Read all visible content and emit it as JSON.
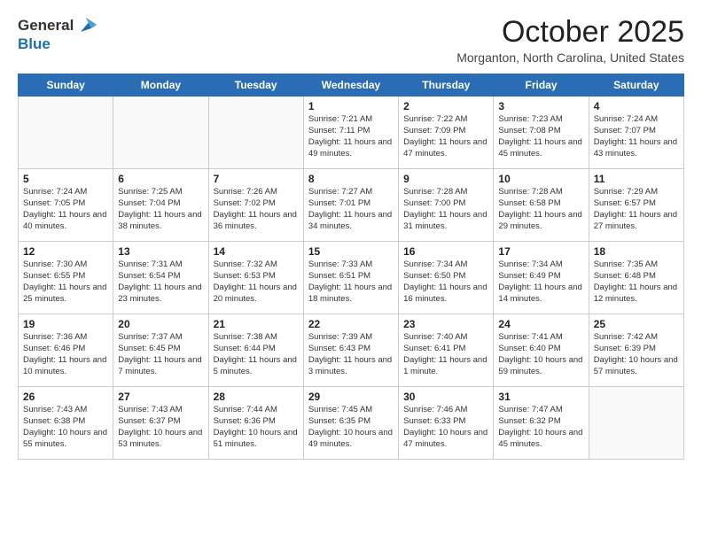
{
  "header": {
    "logo_general": "General",
    "logo_blue": "Blue",
    "month_title": "October 2025",
    "location": "Morganton, North Carolina, United States"
  },
  "days_of_week": [
    "Sunday",
    "Monday",
    "Tuesday",
    "Wednesday",
    "Thursday",
    "Friday",
    "Saturday"
  ],
  "weeks": [
    [
      {
        "day": "",
        "info": ""
      },
      {
        "day": "",
        "info": ""
      },
      {
        "day": "",
        "info": ""
      },
      {
        "day": "1",
        "info": "Sunrise: 7:21 AM\nSunset: 7:11 PM\nDaylight: 11 hours\nand 49 minutes."
      },
      {
        "day": "2",
        "info": "Sunrise: 7:22 AM\nSunset: 7:09 PM\nDaylight: 11 hours\nand 47 minutes."
      },
      {
        "day": "3",
        "info": "Sunrise: 7:23 AM\nSunset: 7:08 PM\nDaylight: 11 hours\nand 45 minutes."
      },
      {
        "day": "4",
        "info": "Sunrise: 7:24 AM\nSunset: 7:07 PM\nDaylight: 11 hours\nand 43 minutes."
      }
    ],
    [
      {
        "day": "5",
        "info": "Sunrise: 7:24 AM\nSunset: 7:05 PM\nDaylight: 11 hours\nand 40 minutes."
      },
      {
        "day": "6",
        "info": "Sunrise: 7:25 AM\nSunset: 7:04 PM\nDaylight: 11 hours\nand 38 minutes."
      },
      {
        "day": "7",
        "info": "Sunrise: 7:26 AM\nSunset: 7:02 PM\nDaylight: 11 hours\nand 36 minutes."
      },
      {
        "day": "8",
        "info": "Sunrise: 7:27 AM\nSunset: 7:01 PM\nDaylight: 11 hours\nand 34 minutes."
      },
      {
        "day": "9",
        "info": "Sunrise: 7:28 AM\nSunset: 7:00 PM\nDaylight: 11 hours\nand 31 minutes."
      },
      {
        "day": "10",
        "info": "Sunrise: 7:28 AM\nSunset: 6:58 PM\nDaylight: 11 hours\nand 29 minutes."
      },
      {
        "day": "11",
        "info": "Sunrise: 7:29 AM\nSunset: 6:57 PM\nDaylight: 11 hours\nand 27 minutes."
      }
    ],
    [
      {
        "day": "12",
        "info": "Sunrise: 7:30 AM\nSunset: 6:55 PM\nDaylight: 11 hours\nand 25 minutes."
      },
      {
        "day": "13",
        "info": "Sunrise: 7:31 AM\nSunset: 6:54 PM\nDaylight: 11 hours\nand 23 minutes."
      },
      {
        "day": "14",
        "info": "Sunrise: 7:32 AM\nSunset: 6:53 PM\nDaylight: 11 hours\nand 20 minutes."
      },
      {
        "day": "15",
        "info": "Sunrise: 7:33 AM\nSunset: 6:51 PM\nDaylight: 11 hours\nand 18 minutes."
      },
      {
        "day": "16",
        "info": "Sunrise: 7:34 AM\nSunset: 6:50 PM\nDaylight: 11 hours\nand 16 minutes."
      },
      {
        "day": "17",
        "info": "Sunrise: 7:34 AM\nSunset: 6:49 PM\nDaylight: 11 hours\nand 14 minutes."
      },
      {
        "day": "18",
        "info": "Sunrise: 7:35 AM\nSunset: 6:48 PM\nDaylight: 11 hours\nand 12 minutes."
      }
    ],
    [
      {
        "day": "19",
        "info": "Sunrise: 7:36 AM\nSunset: 6:46 PM\nDaylight: 11 hours\nand 10 minutes."
      },
      {
        "day": "20",
        "info": "Sunrise: 7:37 AM\nSunset: 6:45 PM\nDaylight: 11 hours\nand 7 minutes."
      },
      {
        "day": "21",
        "info": "Sunrise: 7:38 AM\nSunset: 6:44 PM\nDaylight: 11 hours\nand 5 minutes."
      },
      {
        "day": "22",
        "info": "Sunrise: 7:39 AM\nSunset: 6:43 PM\nDaylight: 11 hours\nand 3 minutes."
      },
      {
        "day": "23",
        "info": "Sunrise: 7:40 AM\nSunset: 6:41 PM\nDaylight: 11 hours\nand 1 minute."
      },
      {
        "day": "24",
        "info": "Sunrise: 7:41 AM\nSunset: 6:40 PM\nDaylight: 10 hours\nand 59 minutes."
      },
      {
        "day": "25",
        "info": "Sunrise: 7:42 AM\nSunset: 6:39 PM\nDaylight: 10 hours\nand 57 minutes."
      }
    ],
    [
      {
        "day": "26",
        "info": "Sunrise: 7:43 AM\nSunset: 6:38 PM\nDaylight: 10 hours\nand 55 minutes."
      },
      {
        "day": "27",
        "info": "Sunrise: 7:43 AM\nSunset: 6:37 PM\nDaylight: 10 hours\nand 53 minutes."
      },
      {
        "day": "28",
        "info": "Sunrise: 7:44 AM\nSunset: 6:36 PM\nDaylight: 10 hours\nand 51 minutes."
      },
      {
        "day": "29",
        "info": "Sunrise: 7:45 AM\nSunset: 6:35 PM\nDaylight: 10 hours\nand 49 minutes."
      },
      {
        "day": "30",
        "info": "Sunrise: 7:46 AM\nSunset: 6:33 PM\nDaylight: 10 hours\nand 47 minutes."
      },
      {
        "day": "31",
        "info": "Sunrise: 7:47 AM\nSunset: 6:32 PM\nDaylight: 10 hours\nand 45 minutes."
      },
      {
        "day": "",
        "info": ""
      }
    ]
  ]
}
